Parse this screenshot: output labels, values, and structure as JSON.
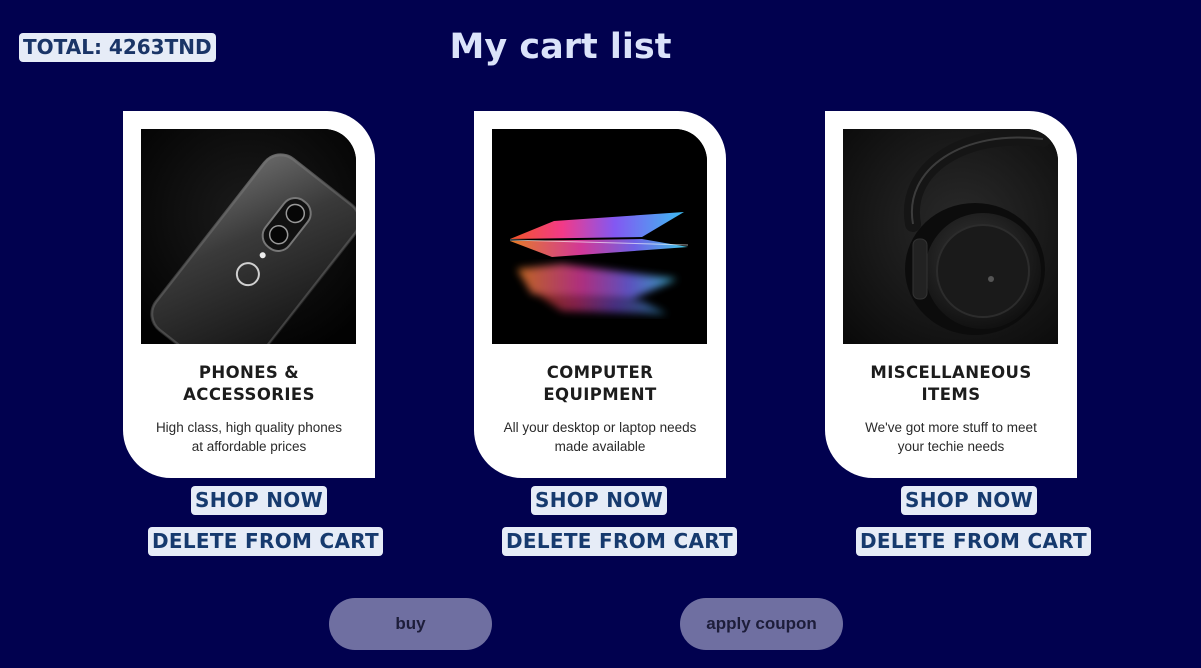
{
  "header": {
    "total": "TOTAL: 4263TND",
    "title": "My cart list"
  },
  "colors": {
    "background": "#01014f",
    "chip_background": "#e6ecf7",
    "chip_text": "#163a6e",
    "pill_button": "#6f6fa1",
    "title_text": "#dbe3fa"
  },
  "cards": [
    {
      "image": "smartphone-photo",
      "title_line1": "PHONES &",
      "title_line2": "ACCESSORIES",
      "desc_line1": "High class, high quality phones",
      "desc_line2": "at affordable prices",
      "shop_label": "SHOP NOW",
      "delete_label": "DELETE FROM CART"
    },
    {
      "image": "laptop-photo",
      "title_line1": "COMPUTER",
      "title_line2": "EQUIPMENT",
      "desc_line1": "All your desktop or laptop needs",
      "desc_line2": "made available",
      "shop_label": "SHOP NOW",
      "delete_label": "DELETE FROM CART"
    },
    {
      "image": "headphones-photo",
      "title_line1": "MISCELLANEOUS",
      "title_line2": "ITEMS",
      "desc_line1": "We've got more stuff to meet",
      "desc_line2": "your techie needs",
      "shop_label": "SHOP NOW",
      "delete_label": "DELETE FROM CART"
    }
  ],
  "actions": {
    "buy_label": "buy",
    "coupon_label": "apply coupon"
  }
}
